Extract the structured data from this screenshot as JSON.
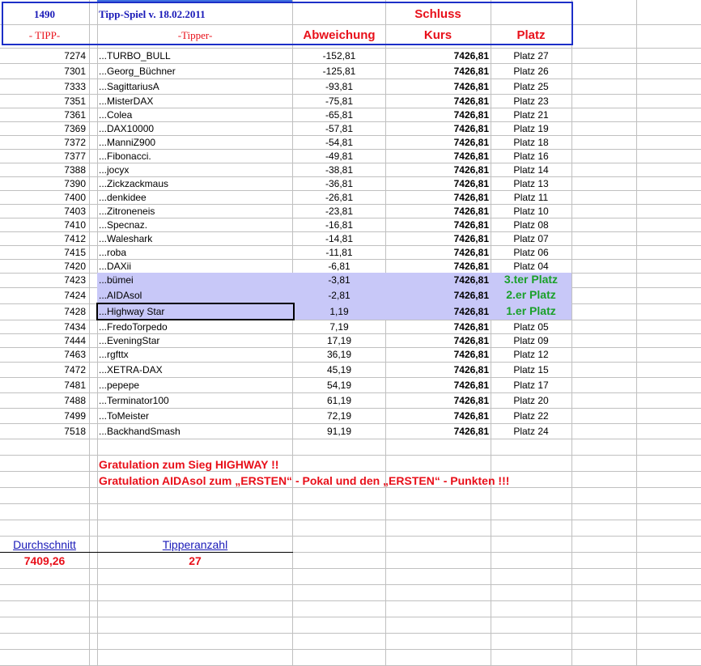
{
  "header": {
    "tipp_number": "1490",
    "title": "Tipp-Spiel v. 18.02.2011",
    "schluss": "Schluss",
    "col_tipp": "- TIPP-",
    "col_tipper": "-Tipper-",
    "col_abweichung": "Abweichung",
    "col_kurs": "Kurs",
    "col_platz": "Platz"
  },
  "rows": [
    {
      "tipp": "7274",
      "name": "...TURBO_BULL",
      "abw": "-152,81",
      "kurs": "7426,81",
      "platz": "Platz 27"
    },
    {
      "tipp": "7301",
      "name": "...Georg_Büchner",
      "abw": "-125,81",
      "kurs": "7426,81",
      "platz": "Platz 26"
    },
    {
      "tipp": "7333",
      "name": "...SagittariusA",
      "abw": "-93,81",
      "kurs": "7426,81",
      "platz": "Platz 25"
    },
    {
      "tipp": "7351",
      "name": "...MisterDAX",
      "abw": "-75,81",
      "kurs": "7426,81",
      "platz": "Platz 23"
    },
    {
      "tipp": "7361",
      "name": "...Colea",
      "abw": "-65,81",
      "kurs": "7426,81",
      "platz": "Platz 21"
    },
    {
      "tipp": "7369",
      "name": "...DAX10000",
      "abw": "-57,81",
      "kurs": "7426,81",
      "platz": "Platz 19"
    },
    {
      "tipp": "7372",
      "name": "...ManniZ900",
      "abw": "-54,81",
      "kurs": "7426,81",
      "platz": "Platz 18"
    },
    {
      "tipp": "7377",
      "name": "...Fibonacci.",
      "abw": "-49,81",
      "kurs": "7426,81",
      "platz": "Platz 16"
    },
    {
      "tipp": "7388",
      "name": "...jocyx",
      "abw": "-38,81",
      "kurs": "7426,81",
      "platz": "Platz 14"
    },
    {
      "tipp": "7390",
      "name": "...Zickzackmaus",
      "abw": "-36,81",
      "kurs": "7426,81",
      "platz": "Platz 13"
    },
    {
      "tipp": "7400",
      "name": "...denkidee",
      "abw": "-26,81",
      "kurs": "7426,81",
      "platz": "Platz 11"
    },
    {
      "tipp": "7403",
      "name": "...Zitroneneis",
      "abw": "-23,81",
      "kurs": "7426,81",
      "platz": "Platz 10"
    },
    {
      "tipp": "7410",
      "name": "...Specnaz.",
      "abw": "-16,81",
      "kurs": "7426,81",
      "platz": "Platz 08"
    },
    {
      "tipp": "7412",
      "name": "...Waleshark",
      "abw": "-14,81",
      "kurs": "7426,81",
      "platz": "Platz 07"
    },
    {
      "tipp": "7415",
      "name": "...roba",
      "abw": "-11,81",
      "kurs": "7426,81",
      "platz": "Platz 06"
    },
    {
      "tipp": "7420",
      "name": "...DAXii",
      "abw": "-6,81",
      "kurs": "7426,81",
      "platz": "Platz 04"
    },
    {
      "tipp": "7423",
      "name": "...bümei",
      "abw": "-3,81",
      "kurs": "7426,81",
      "platz": "3.ter Platz",
      "winner": true
    },
    {
      "tipp": "7424",
      "name": "...AIDAsol",
      "abw": "-2,81",
      "kurs": "7426,81",
      "platz": "2.er Platz",
      "winner": true
    },
    {
      "tipp": "7428",
      "name": "...Highway Star",
      "abw": "1,19",
      "kurs": "7426,81",
      "platz": "1.er Platz",
      "winner": true,
      "selected": true
    },
    {
      "tipp": "7434",
      "name": "...FredoTorpedo",
      "abw": "7,19",
      "kurs": "7426,81",
      "platz": "Platz 05"
    },
    {
      "tipp": "7444",
      "name": "...EveningStar",
      "abw": "17,19",
      "kurs": "7426,81",
      "platz": "Platz 09"
    },
    {
      "tipp": "7463",
      "name": "...rgfttx",
      "abw": "36,19",
      "kurs": "7426,81",
      "platz": "Platz 12"
    },
    {
      "tipp": "7472",
      "name": "...XETRA-DAX",
      "abw": "45,19",
      "kurs": "7426,81",
      "platz": "Platz 15"
    },
    {
      "tipp": "7481",
      "name": "...pepepe",
      "abw": "54,19",
      "kurs": "7426,81",
      "platz": "Platz 17"
    },
    {
      "tipp": "7488",
      "name": "...Terminator100",
      "abw": "61,19",
      "kurs": "7426,81",
      "platz": "Platz 20"
    },
    {
      "tipp": "7499",
      "name": "...ToMeister",
      "abw": "72,19",
      "kurs": "7426,81",
      "platz": "Platz 22"
    },
    {
      "tipp": "7518",
      "name": "...BackhandSmash",
      "abw": "91,19",
      "kurs": "7426,81",
      "platz": "Platz 24"
    }
  ],
  "messages": {
    "line1": "Gratulation zum Sieg HIGHWAY !!",
    "line2": "Gratulation AIDAsol zum „ERSTEN“ - Pokal und den „ERSTEN“ - Punkten !!!"
  },
  "footer": {
    "avg_label": "Durchschnitt",
    "avg_value": "7409,26",
    "count_label": "Tipperanzahl",
    "count_value": "27"
  },
  "colors": {
    "accent_blue": "#1c2fc8",
    "red": "#e8101a",
    "green": "#1aa02a",
    "highlight": "#c8c8f8"
  }
}
